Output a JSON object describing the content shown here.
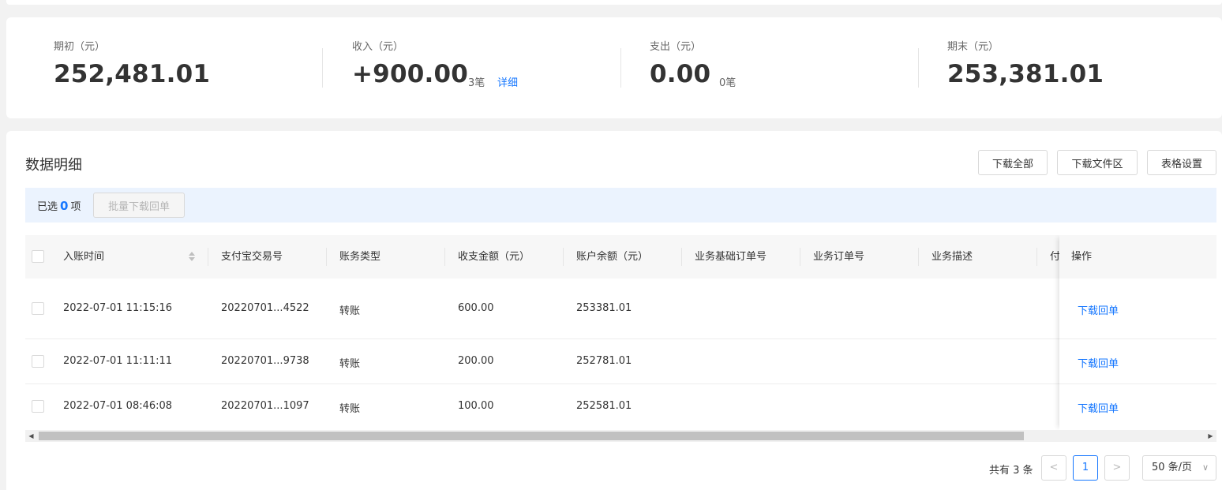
{
  "summary": {
    "opening": {
      "label": "期初（元）",
      "value": "252,481.01"
    },
    "income": {
      "label": "收入（元）",
      "value": "+900.00",
      "count": "3笔",
      "detail": "详细"
    },
    "expense": {
      "label": "支出（元）",
      "value": "0.00",
      "count": "0笔"
    },
    "closing": {
      "label": "期末（元）",
      "value": "253,381.01"
    }
  },
  "panel": {
    "title": "数据明细",
    "buttons": {
      "download_all": "下载全部",
      "download_area": "下载文件区",
      "table_settings": "表格设置"
    },
    "selection": {
      "prefix": "已选",
      "count": "0",
      "suffix": "项",
      "batch_button": "批量下载回单"
    }
  },
  "table": {
    "columns": [
      "入账时间",
      "支付宝交易号",
      "账务类型",
      "收支金额（元）",
      "账户余额（元）",
      "业务基础订单号",
      "业务订单号",
      "业务描述",
      "付"
    ],
    "action_column": "操作",
    "rows": [
      {
        "time": "2022-07-01 11:15:16",
        "trade_no": "20220701...4522",
        "type": "转账",
        "amount": "600.00",
        "balance": "253381.01",
        "action": "下载回单"
      },
      {
        "time": "2022-07-01 11:11:11",
        "trade_no": "20220701...9738",
        "type": "转账",
        "amount": "200.00",
        "balance": "252781.01",
        "action": "下载回单"
      },
      {
        "time": "2022-07-01 08:46:08",
        "trade_no": "20220701...1097",
        "type": "转账",
        "amount": "100.00",
        "balance": "252581.01",
        "action": "下载回单"
      }
    ]
  },
  "pagination": {
    "total": "共有 3 条",
    "prev": "<",
    "current": "1",
    "next": ">",
    "page_size": "50 条/页"
  },
  "colors": {
    "accent": "#1677ff",
    "selection_bg": "#ebf3fe"
  }
}
